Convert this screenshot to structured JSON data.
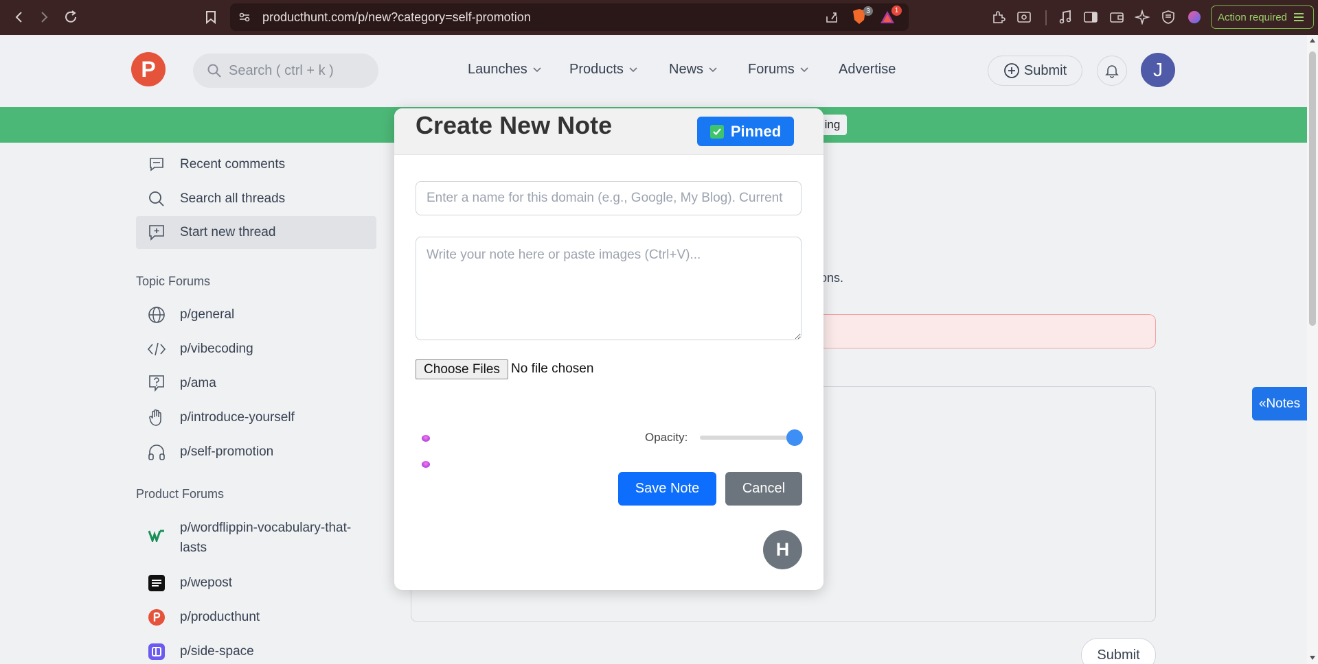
{
  "browser": {
    "url": "producthunt.com/p/new?category=self-promotion",
    "shield_count": "3",
    "alert_count": "1",
    "action_required": "Action required"
  },
  "header": {
    "logo_letter": "P",
    "search_placeholder": "Search ( ctrl + k )",
    "nav": [
      "Launches",
      "Products",
      "News",
      "Forums",
      "Advertise"
    ],
    "submit_label": "Submit",
    "avatar_letter": "J"
  },
  "banner": {
    "tag_text": "ing"
  },
  "sidebar": {
    "top_items": [
      "Recent comments",
      "Search all threads",
      "Start new thread"
    ],
    "topic_heading": "Topic Forums",
    "topic_items": [
      "p/general",
      "p/vibecoding",
      "p/ama",
      "p/introduce-yourself",
      "p/self-promotion"
    ],
    "product_heading": "Product Forums",
    "product_items": [
      "p/wordflippin-vocabulary-that-lasts",
      "p/wepost",
      "p/producthunt",
      "p/side-space"
    ]
  },
  "background": {
    "partial_text": "ions.",
    "submit_label": "Submit"
  },
  "notes_tab": "«Notes",
  "modal": {
    "title": "Create New Note",
    "pinned_label": "Pinned",
    "domain_placeholder": "Enter a name for this domain (e.g., Google, My Blog). Current",
    "note_placeholder": "Write your note here or paste images (Ctrl+V)...",
    "choose_files": "Choose Files",
    "no_file": "No file chosen",
    "opacity_label": "Opacity:",
    "opacity_value": 1.0,
    "save_label": "Save Note",
    "cancel_label": "Cancel",
    "h_button": "H"
  }
}
